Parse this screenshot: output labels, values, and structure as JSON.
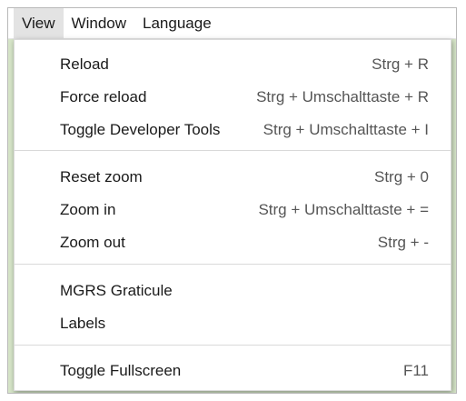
{
  "menubar": {
    "items": [
      {
        "label": "View",
        "active": true
      },
      {
        "label": "Window",
        "active": false
      },
      {
        "label": "Language",
        "active": false
      }
    ]
  },
  "view_menu": {
    "groups": [
      [
        {
          "label": "Reload",
          "shortcut": "Strg + R"
        },
        {
          "label": "Force reload",
          "shortcut": "Strg + Umschalttaste + R"
        },
        {
          "label": "Toggle Developer Tools",
          "shortcut": "Strg + Umschalttaste + I"
        }
      ],
      [
        {
          "label": "Reset zoom",
          "shortcut": "Strg + 0"
        },
        {
          "label": "Zoom in",
          "shortcut": "Strg + Umschalttaste + ="
        },
        {
          "label": "Zoom out",
          "shortcut": "Strg + -"
        }
      ],
      [
        {
          "label": "MGRS Graticule",
          "shortcut": ""
        },
        {
          "label": "Labels",
          "shortcut": ""
        }
      ],
      [
        {
          "label": "Toggle Fullscreen",
          "shortcut": "F11"
        }
      ]
    ]
  }
}
